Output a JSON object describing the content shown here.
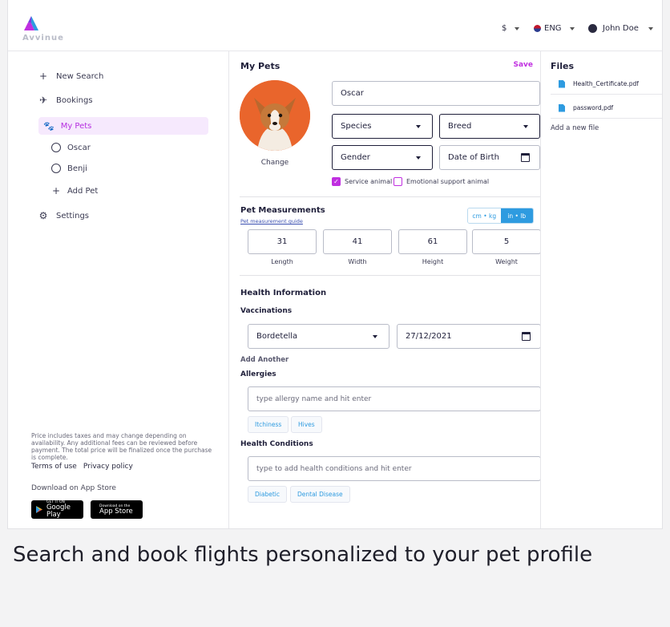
{
  "brand": {
    "name": "Avvinue"
  },
  "topbar": {
    "currency": "$",
    "language": "ENG",
    "user": "John Doe"
  },
  "sidebar": {
    "new_search": "New Search",
    "bookings": "Bookings",
    "my_pets": "My Pets",
    "pets": [
      "Oscar",
      "Benji"
    ],
    "add_pet": "Add Pet",
    "settings": "Settings",
    "disclaimer": "Price includes taxes and may change depending on availability. Any additional fees can be reviewed before payment. The total price will be finalized once the purchase is complete.",
    "terms": "Terms of use",
    "privacy": "Privacy policy",
    "download_label": "Download on App Store",
    "google_small": "GET IT ON",
    "google_big": "Google Play",
    "apple_small": "Download on the",
    "apple_big": "App Store"
  },
  "pet_form": {
    "title": "My Pets",
    "save": "Save",
    "name": "Oscar",
    "species": "Species",
    "breed": "Breed",
    "gender": "Gender",
    "dob": "Date of Birth",
    "change": "Change",
    "service_animal": "Service animal",
    "service_animal_checked": true,
    "emotional_support": "Emotional support animal",
    "emotional_support_checked": false
  },
  "measurements": {
    "title": "Pet Measurements",
    "guide": "Pet measurement guide",
    "unit_metric": "cm • kg",
    "unit_imperial": "in • lb",
    "active_unit": "in • lb",
    "values": [
      {
        "value": "31",
        "label": "Length"
      },
      {
        "value": "41",
        "label": "Width"
      },
      {
        "value": "61",
        "label": "Height"
      },
      {
        "value": "5",
        "label": "Weight"
      }
    ]
  },
  "health": {
    "title": "Health Information",
    "vaccinations_title": "Vaccinations",
    "vaccine": "Bordetella",
    "vaccine_date": "27/12/2021",
    "add_another": "Add Another",
    "allergies_title": "Allergies",
    "allergies_placeholder": "type allergy name and hit enter",
    "allergies": [
      "Itchiness",
      "Hives"
    ],
    "conditions_title": "Health Conditions",
    "conditions_placeholder": "type to add health conditions and hit enter",
    "conditions": [
      "Diabetic",
      "Dental Disease"
    ]
  },
  "files": {
    "title": "Files",
    "items": [
      "Health_Certificate.pdf",
      "password,pdf"
    ],
    "add": "Add a new file"
  },
  "caption": "Search and book flights personalized to your pet profile",
  "colors": {
    "accent": "#c02fe0",
    "accent_light": "#f6e9fd",
    "info": "#2e9be0",
    "pet_photo_bg": "#e9652c"
  }
}
